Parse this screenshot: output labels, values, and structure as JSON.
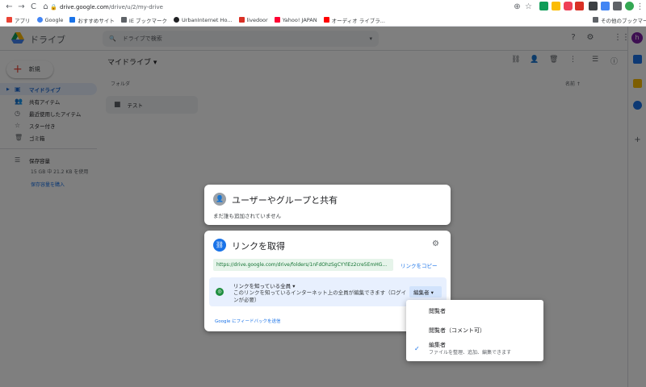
{
  "browser": {
    "url_host": "drive.google.com",
    "url_path": "/drive/u/2/my-drive",
    "bookmarks": [
      {
        "label": "アプリ",
        "color": "#ea4335"
      },
      {
        "label": "Google",
        "color": "#4285f4"
      },
      {
        "label": "おすすめサイト",
        "color": "#1a73e8"
      },
      {
        "label": "IE ブックマーク",
        "color": "#5f6368"
      },
      {
        "label": "UrbanInternet Ho...",
        "color": "#202124"
      },
      {
        "label": "livedoor",
        "color": "#d93025"
      },
      {
        "label": "Yahoo! JAPAN",
        "color": "#ff0033"
      },
      {
        "label": "オーディオ ライブラ...",
        "color": "#ff0000"
      }
    ],
    "other_bookmarks": "その他のブックマーク"
  },
  "drive": {
    "app_title": "ドライブ",
    "search_placeholder": "ドライブで検索",
    "new_button": "新規",
    "breadcrumb": "マイドライブ ▾",
    "nav": [
      {
        "label": "マイドライブ",
        "icon": "▣",
        "active": true
      },
      {
        "label": "共有アイテム",
        "icon": "👥",
        "active": false
      },
      {
        "label": "最近使用したアイテム",
        "icon": "◷",
        "active": false
      },
      {
        "label": "スター付き",
        "icon": "☆",
        "active": false
      },
      {
        "label": "ゴミ箱",
        "icon": "🗑",
        "active": false
      }
    ],
    "storage_label": "保存容量",
    "storage_usage": "15 GB 中 21.2 KB を使用",
    "buy_storage": "保存容量を購入",
    "folder_section": "フォルダ",
    "sort_label": "名前 ↑",
    "folder_name": "テスト",
    "avatar_letter": "h"
  },
  "share_dialog": {
    "title": "ユーザーやグループと共有",
    "subtitle": "まだ誰も追加されていません"
  },
  "link_dialog": {
    "title": "リンクを取得",
    "url": "https://drive.google.com/drive/folders/1nFdOhzSgCYYlEz2cre5EmHG...",
    "copy_link": "リンクをコピー",
    "access_title": "リンクを知っている全員 ▾",
    "access_desc": "このリンクを知っているインターネット上の全員が編集できます（ログインが必要）",
    "role_button": "編集者 ▾",
    "feedback": "Google にフィードバックを送信"
  },
  "role_menu": {
    "items": [
      {
        "label": "閲覧者",
        "desc": "",
        "checked": false
      },
      {
        "label": "閲覧者（コメント可）",
        "desc": "",
        "checked": false
      },
      {
        "label": "編集者",
        "desc": "ファイルを整理、追加、編集できます",
        "checked": true
      }
    ]
  }
}
